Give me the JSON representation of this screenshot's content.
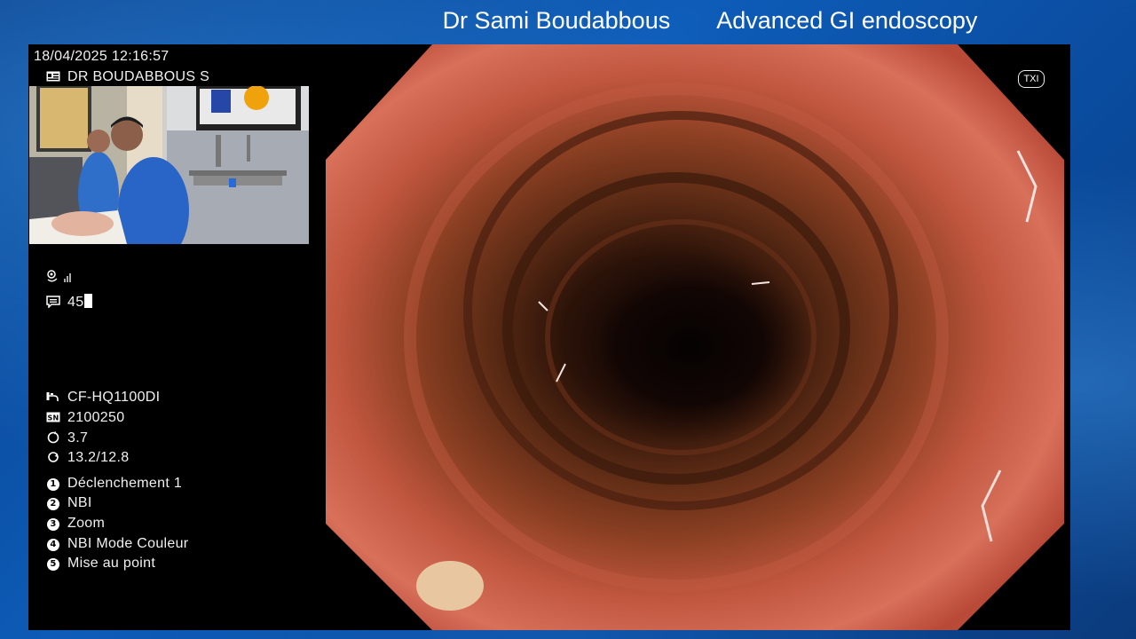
{
  "header": {
    "doctor": "Dr Sami Boudabbous",
    "specialty": "Advanced GI endoscopy"
  },
  "monitor": {
    "datetime": "18/04/2025   12:16:57",
    "physician": "DR BOUDABBOUS S",
    "comment_count": "45",
    "txi_badge": "TXI",
    "scope_model": "CF-HQ1100DI",
    "serial": "2100250",
    "value_a": "3.7",
    "value_b": "13.2/12.8",
    "buttons": [
      {
        "num": "1",
        "label": "Déclenchement 1"
      },
      {
        "num": "2",
        "label": "NBI"
      },
      {
        "num": "3",
        "label": "Zoom"
      },
      {
        "num": "4",
        "label": "NBI Mode Couleur"
      },
      {
        "num": "5",
        "label": "Mise au point"
      }
    ]
  },
  "colors": {
    "background": "#0d5cb8",
    "monitor": "#000000",
    "mucosa": "#c85a48"
  }
}
